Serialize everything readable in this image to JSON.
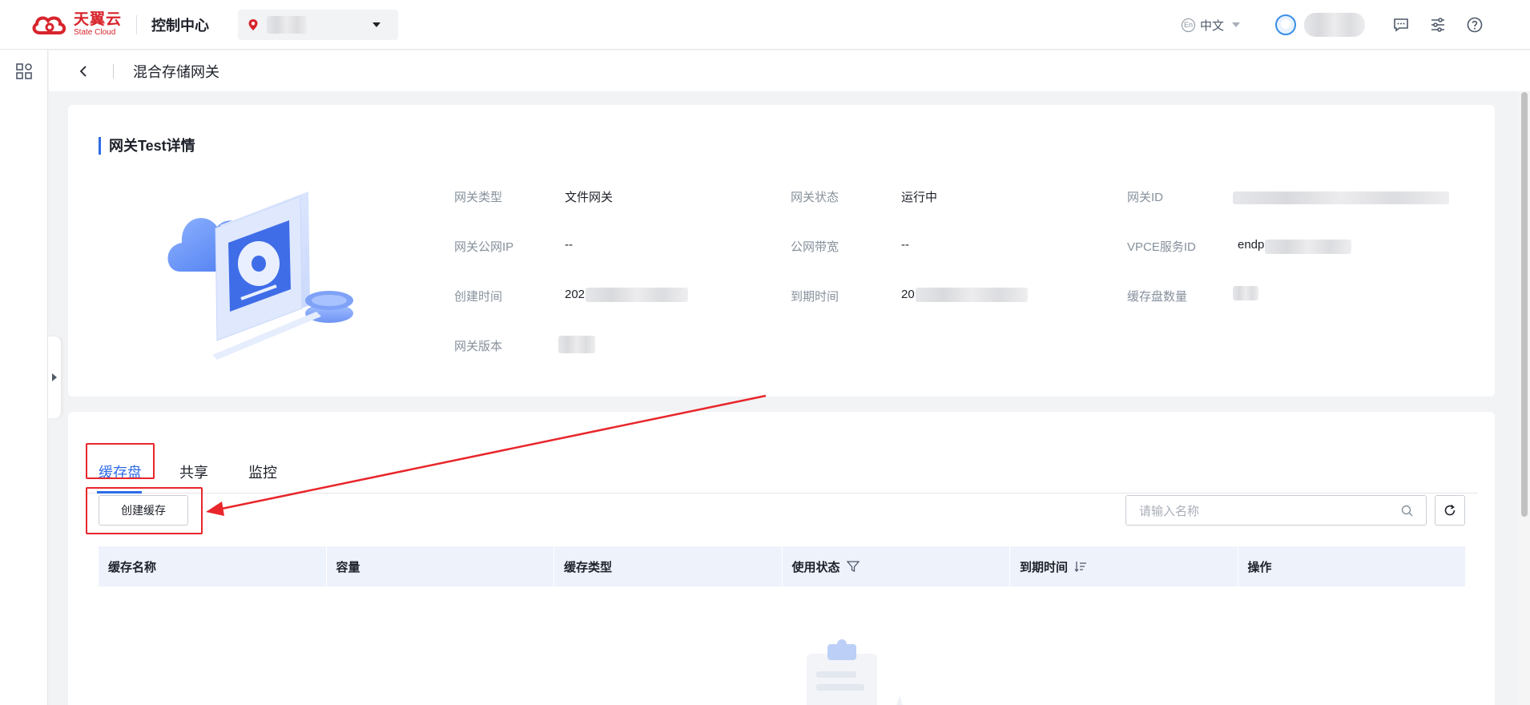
{
  "header": {
    "brand_cn": "天翼云",
    "brand_en": "State Cloud",
    "console_title": "控制中心",
    "language": "中文",
    "lang_badge": "En"
  },
  "subheader": {
    "title": "混合存储网关"
  },
  "gateway_detail": {
    "section_title": "网关Test详情",
    "fields": {
      "type_label": "网关类型",
      "type_value": "文件网关",
      "status_label": "网关状态",
      "status_value": "运行中",
      "id_label": "网关ID",
      "public_ip_label": "网关公网IP",
      "public_ip_value": "--",
      "bandwidth_label": "公网带宽",
      "bandwidth_value": "--",
      "vpce_label": "VPCE服务ID",
      "vpce_value_prefix": "endp",
      "created_label": "创建时间",
      "created_value_prefix": "202",
      "expire_label": "到期时间",
      "expire_value_prefix": "20",
      "cache_count_label": "缓存盘数量",
      "version_label": "网关版本"
    }
  },
  "tabs": [
    {
      "label": "缓存盘",
      "active": true
    },
    {
      "label": "共享",
      "active": false
    },
    {
      "label": "监控",
      "active": false
    }
  ],
  "toolbar": {
    "create_label": "创建缓存",
    "search_placeholder": "请输入名称"
  },
  "table": {
    "columns": [
      "缓存名称",
      "容量",
      "缓存类型",
      "使用状态",
      "到期时间",
      "操作"
    ]
  },
  "colors": {
    "accent": "#2e6be6",
    "brand_red": "#d8242c",
    "annotation_red": "#e8262b"
  },
  "icons": [
    "location-pin-icon",
    "chevron-down-icon",
    "message-icon",
    "settings-sliders-icon",
    "help-icon",
    "grid-apps-icon",
    "back-arrow-icon",
    "search-icon",
    "refresh-icon",
    "filter-icon",
    "sort-icon",
    "expand-arrow-icon"
  ]
}
